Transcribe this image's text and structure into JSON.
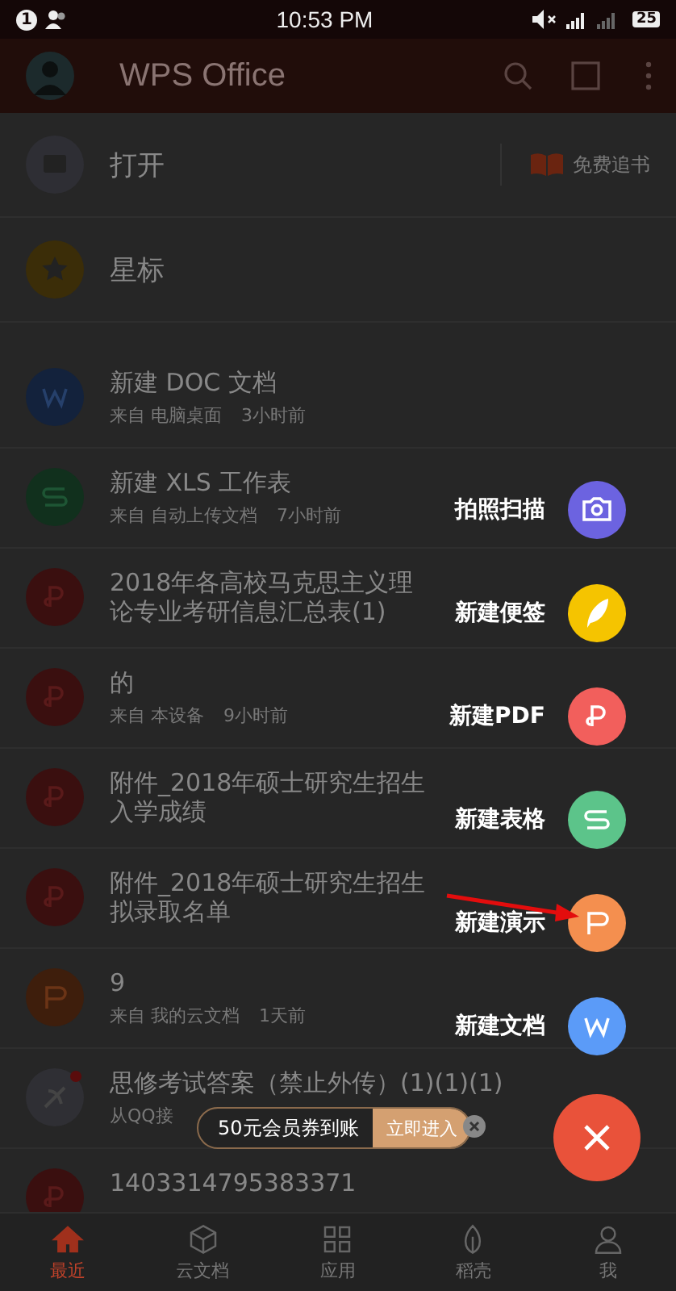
{
  "status_bar": {
    "notification": "1",
    "time": "10:53 PM",
    "battery": "25"
  },
  "app_bar": {
    "title": "WPS Office"
  },
  "quick": [
    {
      "kind": "open",
      "label": "打开",
      "aside": "免费追书"
    },
    {
      "kind": "star",
      "label": "星标"
    }
  ],
  "files": [
    {
      "kind": "doc",
      "title": "新建 DOC 文档",
      "source": "来自 电脑桌面",
      "time": "3小时前"
    },
    {
      "kind": "xls",
      "title": "新建 XLS 工作表",
      "source": "来自 自动上传文档",
      "time": "7小时前"
    },
    {
      "kind": "pdf",
      "title": "2018年各高校马克思主义理论专业考研信息汇总表(1)"
    },
    {
      "kind": "pdf",
      "title": "的",
      "source": "来自 本设备",
      "time": "9小时前"
    },
    {
      "kind": "pdf",
      "title": "附件_2018年硕士研究生招生入学成绩"
    },
    {
      "kind": "pdf",
      "title": "附件_2018年硕士研究生招生拟录取名单"
    },
    {
      "kind": "ppt",
      "title": "9",
      "source": "来自 我的云文档",
      "time": "1天前"
    },
    {
      "kind": "qq",
      "title": "思修考试答案（禁止外传）(1)(1)(1)",
      "source": "从QQ接"
    },
    {
      "kind": "pdf",
      "title": "1403314795383371"
    }
  ],
  "fab_menu": [
    {
      "kind": "scan",
      "label": "拍照扫描",
      "color": "#6c63e0"
    },
    {
      "kind": "note",
      "label": "新建便签",
      "color": "#f5c400"
    },
    {
      "kind": "pdf",
      "label": "新建PDF",
      "color": "#f25f5c"
    },
    {
      "kind": "xls",
      "label": "新建表格",
      "color": "#5cc48a"
    },
    {
      "kind": "ppt",
      "label": "新建演示",
      "color": "#f48f4f"
    },
    {
      "kind": "doc",
      "label": "新建文档",
      "color": "#5b9bf8"
    }
  ],
  "promo": {
    "text": "50元会员券到账",
    "action": "立即进入"
  },
  "nav": [
    {
      "kind": "home",
      "label": "最近",
      "selected": true
    },
    {
      "kind": "cloud",
      "label": "云文档",
      "selected": false
    },
    {
      "kind": "apps",
      "label": "应用",
      "selected": false
    },
    {
      "kind": "leaf",
      "label": "稻壳",
      "selected": false
    },
    {
      "kind": "user",
      "label": "我",
      "selected": false
    }
  ]
}
